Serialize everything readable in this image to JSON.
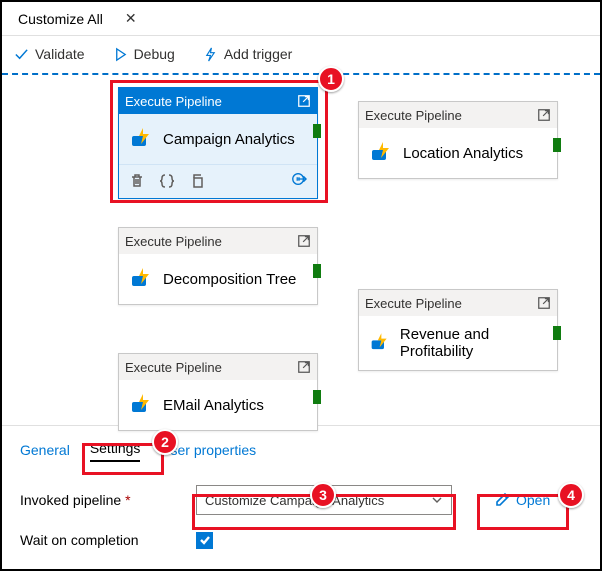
{
  "topbar": {
    "title": "Customize All",
    "close": "✕"
  },
  "toolbar": {
    "validate_label": "Validate",
    "debug_label": "Debug",
    "trigger_label": "Add trigger"
  },
  "nodes": {
    "type_label": "Execute Pipeline",
    "campaign": "Campaign Analytics",
    "location": "Location Analytics",
    "decomp": "Decomposition Tree",
    "revenue": "Revenue and Profitability",
    "email": "EMail Analytics"
  },
  "tabs": {
    "general": "General",
    "settings": "Settings",
    "userprops": "User properties"
  },
  "settings": {
    "invoked_label": "Invoked pipeline",
    "invoked_value": "Customize Campaign Analytics",
    "open_label": "Open",
    "wait_label": "Wait on completion",
    "wait_checked": true
  },
  "badges": {
    "b1": "1",
    "b2": "2",
    "b3": "3",
    "b4": "4"
  }
}
